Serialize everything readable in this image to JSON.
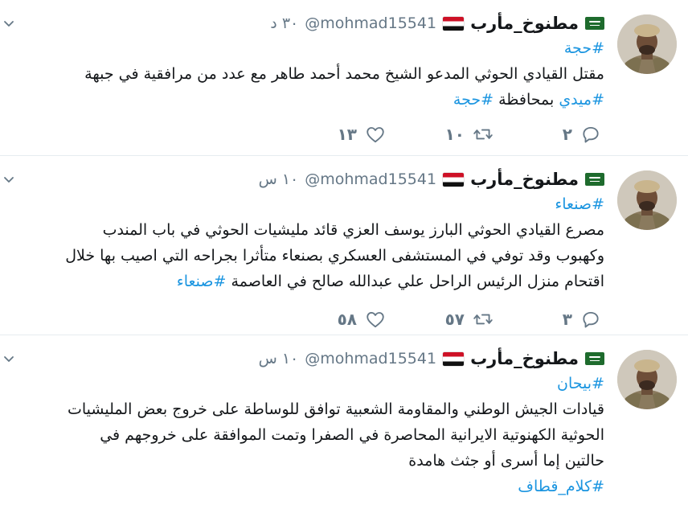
{
  "colors": {
    "link": "#1b95e0",
    "muted": "#657786",
    "text": "#14171a",
    "divider": "#e6ecf0"
  },
  "tweets": [
    {
      "name": "مطنوخ_مأرب",
      "handle": "@mohmad15541",
      "time": "٣٠ د",
      "lines": [
        [
          {
            "t": "#حجة",
            "tag": true
          }
        ],
        [
          {
            "t": "مقتل القيادي الحوثي المدعو الشيخ محمد أحمد طاهر مع عدد من مرافقية في جبهة",
            "tag": false
          }
        ],
        [
          {
            "t": "#ميدي",
            "tag": true
          },
          {
            "t": " بمحافظة ",
            "tag": false
          },
          {
            "t": "#حجة",
            "tag": true
          }
        ]
      ],
      "replies": "٢",
      "retweets": "١٠",
      "likes": "١٣"
    },
    {
      "name": "مطنوخ_مأرب",
      "handle": "@mohmad15541",
      "time": "١٠ س",
      "lines": [
        [
          {
            "t": "#صنعاء",
            "tag": true
          }
        ],
        [
          {
            "t": "مصرع القيادي الحوثي البارز يوسف العزي قائد مليشيات الحوثي في باب المندب",
            "tag": false
          }
        ],
        [
          {
            "t": "وكهبوب وقد توفي في المستشفى العسكري بصنعاء متأثرا بجراحه التي اصيب بها خلال",
            "tag": false
          }
        ],
        [
          {
            "t": "اقتحام منزل الرئيس الراحل علي عبدالله صالح في العاصمة ",
            "tag": false
          },
          {
            "t": "#صنعاء",
            "tag": true
          }
        ]
      ],
      "replies": "٣",
      "retweets": "٥٧",
      "likes": "٥٨"
    },
    {
      "name": "مطنوخ_مأرب",
      "handle": "@mohmad15541",
      "time": "١٠ س",
      "lines": [
        [
          {
            "t": "#بيحان",
            "tag": true
          }
        ],
        [
          {
            "t": "قيادات الجيش الوطني والمقاومة الشعبية  توافق للوساطة على خروج بعض المليشيات",
            "tag": false
          }
        ],
        [
          {
            "t": "الحوثية الكهنوتية الايرانية  المحاصرة في الصفرا وتمت الموافقة على خروجهم في",
            "tag": false
          }
        ],
        [
          {
            "t": "حالتين إما أسرى أو جثث هامدة",
            "tag": false
          }
        ],
        [
          {
            "t": "#كلام_قطاف",
            "tag": true
          }
        ]
      ],
      "replies": "",
      "retweets": "",
      "likes": ""
    }
  ]
}
